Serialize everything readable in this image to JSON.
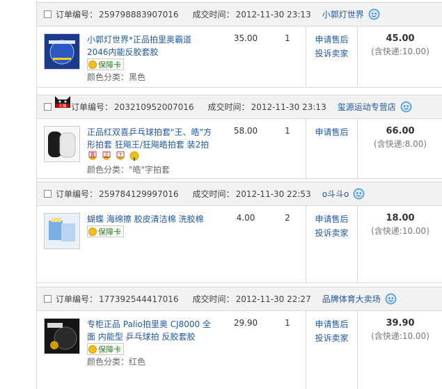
{
  "labels": {
    "order_no": "订单编号：",
    "deal_time": "成交时间：",
    "apply_after_sale": "申请售后",
    "complain_seller": "投诉卖家",
    "spec_prefix": "颜色分类：",
    "guarantee": "保障卡"
  },
  "colors": {
    "link": "#2258a5",
    "header_bg": "#f2f2f2",
    "border": "#d9d9d9"
  },
  "orders": [
    {
      "order_no": "259798883907016",
      "time": "2012-11-30 23:13",
      "shop": "小郭灯世界",
      "title": "小郭灯世界*正品拍里奥霸道2046内能反胶套胶",
      "price": "35.00",
      "qty": "1",
      "spec": "颜色分类：黑色",
      "total": "45.00",
      "shipping": "(含快递:10.00)",
      "icons": [
        "guarantee-card-icon"
      ],
      "tmall": false
    },
    {
      "order_no": "203210952007016",
      "time": "2012-11-30 23:13",
      "shop": "玺源运动专营店",
      "shop_badge": "天猫",
      "title": "正品红双喜乒乓球拍套\"王、皓\"方形拍套 狂飚王/狂飚皓拍套 装2拍",
      "price": "58.00",
      "qty": "1",
      "spec": "颜色分类：\"皓\"字拍套",
      "total": "66.00",
      "shipping": "(含快递:8.00)",
      "mini_badges": [
        "真",
        "正",
        "7"
      ],
      "tmall": true
    },
    {
      "order_no": "259784129997016",
      "time": "2012-11-30 22:53",
      "shop": "o斗斗o",
      "title": "蝴蝶 海绵擦 胶皮清洁棉 洗胶棉",
      "price": "4.00",
      "qty": "2",
      "spec": "",
      "total": "18.00",
      "shipping": "(含快递:10.00)",
      "tmall": false
    },
    {
      "order_no": "177392544417016",
      "time": "2012-11-30 22:27",
      "shop": "品牌体育大卖场",
      "title": "专柜正品 Palio拍里奥 CJ8000 全面 内能型 乒乓球拍 反胶套胶",
      "price": "29.90",
      "qty": "1",
      "spec": "颜色分类：红色",
      "total": "39.90",
      "shipping": "(含快递:10.00)",
      "tmall": false
    }
  ]
}
